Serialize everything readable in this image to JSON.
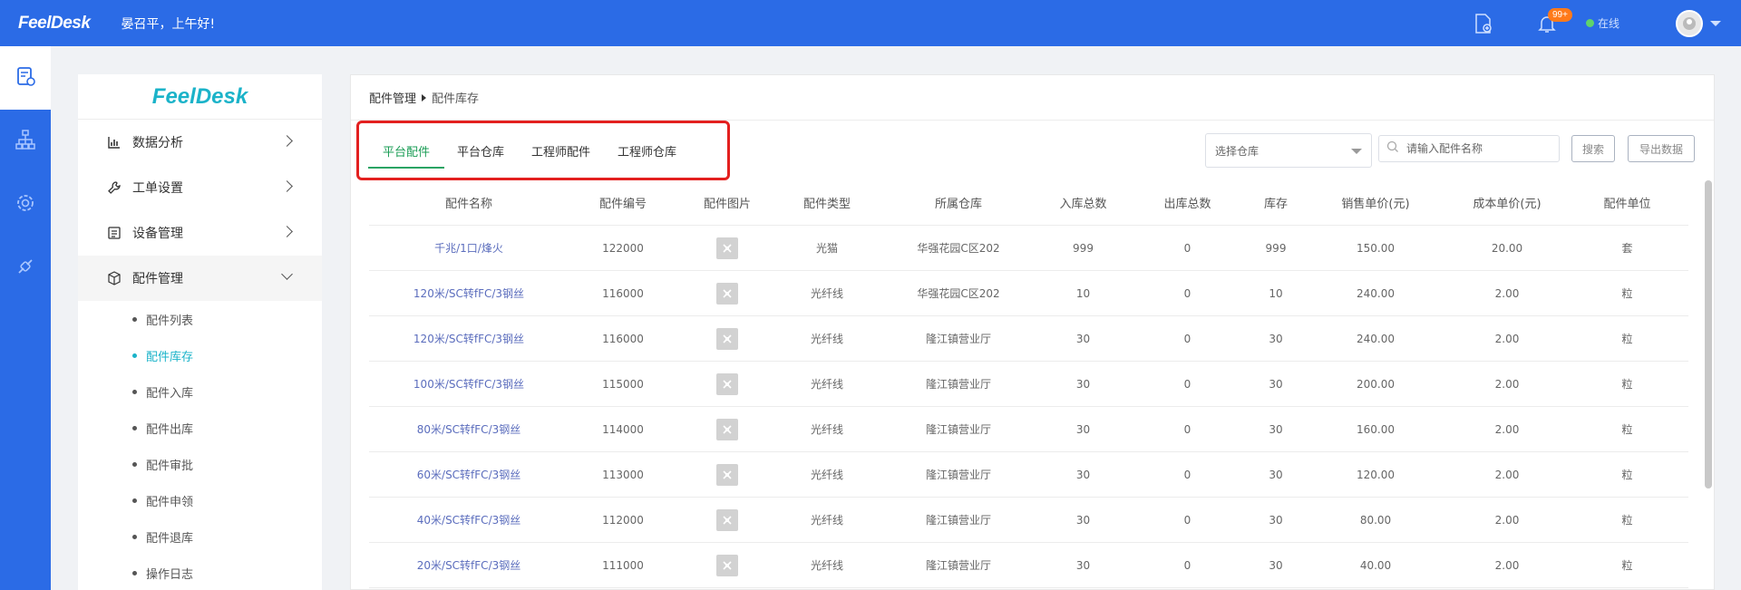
{
  "header": {
    "brand": "FeelDesk",
    "greeting": "晏召平，上午好!",
    "badge": "99+",
    "status": "在线"
  },
  "colors": {
    "primary": "#2b6be6",
    "accent": "#1bb3c9",
    "tab_active": "#1a9c55",
    "highlight_border": "#e3201f"
  },
  "rail": {
    "items": [
      {
        "icon": "clipboard-gear-icon",
        "active": true
      },
      {
        "icon": "org-chart-icon",
        "active": false
      },
      {
        "icon": "gear-icon",
        "active": false
      },
      {
        "icon": "plug-icon",
        "active": false
      }
    ]
  },
  "sidebar": {
    "logo": "FeelDesk",
    "menu": [
      {
        "label": "数据分析",
        "icon": "bar-chart-icon"
      },
      {
        "label": "工单设置",
        "icon": "wrench-icon"
      },
      {
        "label": "设备管理",
        "icon": "device-list-icon"
      },
      {
        "label": "配件管理",
        "icon": "box-icon"
      }
    ],
    "sub": [
      "配件列表",
      "配件库存",
      "配件入库",
      "配件出库",
      "配件审批",
      "配件申领",
      "配件退库",
      "操作日志"
    ]
  },
  "breadcrumb": {
    "parent": "配件管理",
    "current": "配件库存"
  },
  "tabs": [
    "平台配件",
    "平台仓库",
    "工程师配件",
    "工程师仓库"
  ],
  "filters": {
    "warehouse_placeholder": "选择仓库",
    "search_placeholder": "请输入配件名称",
    "search_button": "搜索",
    "export_button": "导出数据"
  },
  "table": {
    "columns": [
      "配件名称",
      "配件编号",
      "配件图片",
      "配件类型",
      "所属仓库",
      "入库总数",
      "出库总数",
      "库存",
      "销售单价(元)",
      "成本单价(元)",
      "配件单位"
    ],
    "rows": [
      [
        "千兆/1口/烽火",
        "122000",
        "",
        "光猫",
        "华强花园C区202",
        "999",
        "0",
        "999",
        "150.00",
        "20.00",
        "套"
      ],
      [
        "120米/SC转fFC/3钢丝",
        "116000",
        "",
        "光纤线",
        "华强花园C区202",
        "10",
        "0",
        "10",
        "240.00",
        "2.00",
        "粒"
      ],
      [
        "120米/SC转fFC/3钢丝",
        "116000",
        "",
        "光纤线",
        "隆江镇营业厅",
        "30",
        "0",
        "30",
        "240.00",
        "2.00",
        "粒"
      ],
      [
        "100米/SC转fFC/3钢丝",
        "115000",
        "",
        "光纤线",
        "隆江镇营业厅",
        "30",
        "0",
        "30",
        "200.00",
        "2.00",
        "粒"
      ],
      [
        "80米/SC转fFC/3钢丝",
        "114000",
        "",
        "光纤线",
        "隆江镇营业厅",
        "30",
        "0",
        "30",
        "160.00",
        "2.00",
        "粒"
      ],
      [
        "60米/SC转fFC/3钢丝",
        "113000",
        "",
        "光纤线",
        "隆江镇营业厅",
        "30",
        "0",
        "30",
        "120.00",
        "2.00",
        "粒"
      ],
      [
        "40米/SC转fFC/3钢丝",
        "112000",
        "",
        "光纤线",
        "隆江镇营业厅",
        "30",
        "0",
        "30",
        "80.00",
        "2.00",
        "粒"
      ],
      [
        "20米/SC转fFC/3钢丝",
        "111000",
        "",
        "光纤线",
        "隆江镇营业厅",
        "30",
        "0",
        "30",
        "40.00",
        "2.00",
        "粒"
      ]
    ]
  }
}
